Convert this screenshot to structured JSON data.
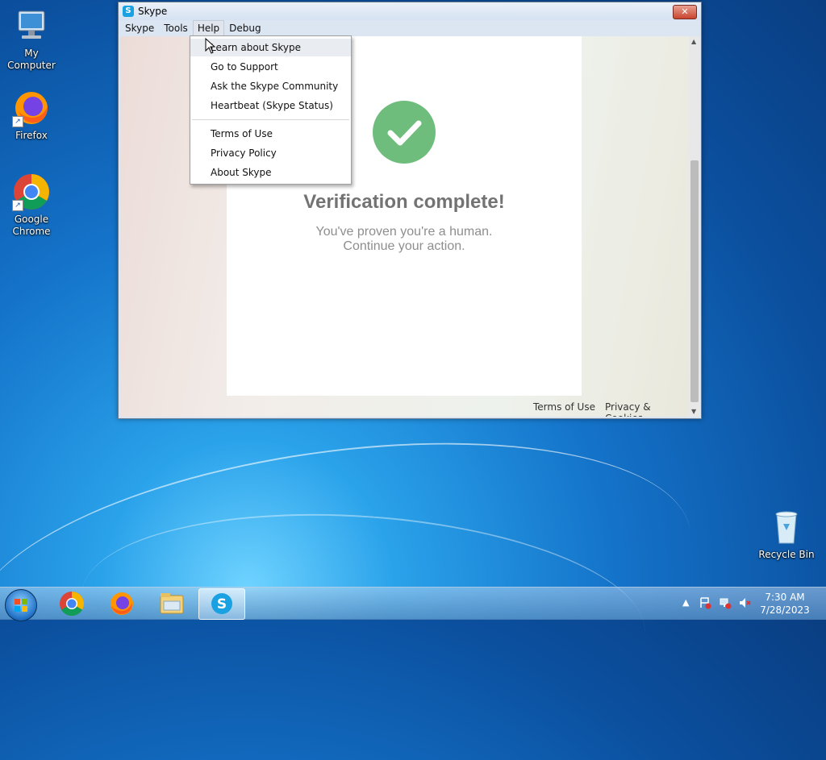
{
  "desktop": {
    "icons": [
      {
        "label": "My Computer",
        "icon": "computer-icon"
      },
      {
        "label": "Firefox",
        "icon": "firefox-icon"
      },
      {
        "label": "Google Chrome",
        "icon": "chrome-icon"
      },
      {
        "label": "Recycle Bin",
        "icon": "recycle-bin-icon"
      }
    ]
  },
  "window": {
    "title": "Skype",
    "app_icon": "S",
    "close_glyph": "✕",
    "menu": [
      "Skype",
      "Tools",
      "Help",
      "Debug"
    ],
    "active_menu": "Help"
  },
  "help_menu": {
    "items": [
      "Learn about Skype",
      "Go to Support",
      "Ask the Skype Community",
      "Heartbeat (Skype Status)",
      "Terms of Use",
      "Privacy Policy",
      "About Skype"
    ]
  },
  "verification": {
    "title": "Verification complete!",
    "line1": "You've proven you're a human.",
    "line2": "Continue your action."
  },
  "footer": {
    "terms": "Terms of Use",
    "privacy": "Privacy & Cookies"
  },
  "taskbar": {
    "apps": [
      "chrome-icon",
      "firefox-icon",
      "file-explorer-icon",
      "skype-icon"
    ],
    "active_app": "skype-icon",
    "time": "7:30 AM",
    "date": "7/28/2023"
  },
  "colors": {
    "check_green": "#6fbd7c",
    "skype_blue": "#1aa1e1"
  }
}
